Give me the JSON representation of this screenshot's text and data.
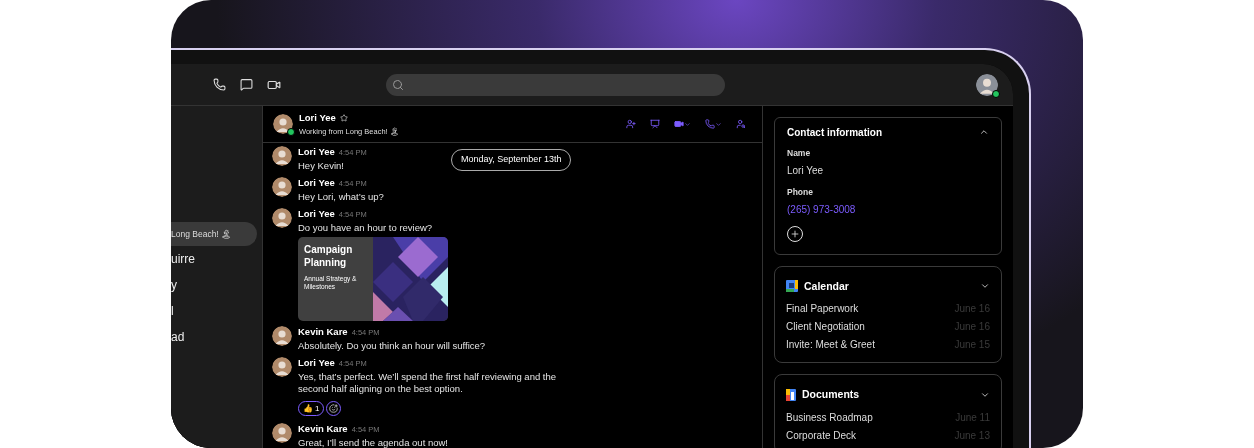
{
  "user": {
    "online": true
  },
  "sidebar": {
    "items": [
      {
        "label": "Long Beach! 🏝",
        "selected": true
      },
      {
        "label": "uirre",
        "selected": false
      },
      {
        "label": "y",
        "selected": false
      },
      {
        "label": "l",
        "selected": false
      },
      {
        "label": "ad",
        "selected": false
      }
    ]
  },
  "chat": {
    "header": {
      "name": "Lori Yee",
      "status": "Working from Long Beach! 🏝",
      "starred": false,
      "online": true
    },
    "date": "Monday, September 13th",
    "messages": [
      {
        "kind": "text",
        "sender": "Lori Yee",
        "time": "4:54 PM",
        "text": "Hey Kevin!"
      },
      {
        "kind": "text",
        "sender": "Lori Yee",
        "time": "4:54 PM",
        "text": "Hey Lori, what’s up?"
      },
      {
        "kind": "attachment",
        "sender": "Lori Yee",
        "time": "4:54 PM",
        "text": "Do you have an hour to review?",
        "attachment": {
          "title": "Campaign Planning",
          "subtitle": "Annual Strategy & Milestones"
        }
      },
      {
        "kind": "text",
        "sender": "Kevin Kare",
        "time": "4:54 PM",
        "text": "Absolutely. Do you think an hour will suffice?"
      },
      {
        "kind": "text",
        "sender": "Lori Yee",
        "time": "4:54 PM",
        "text": "Yes, that’s perfect. We’ll spend the first half reviewing and the second half aligning on the best option.",
        "reactions": [
          {
            "emoji": "👍",
            "count": "1",
            "selected": true
          }
        ]
      },
      {
        "kind": "text",
        "sender": "Kevin Kare",
        "time": "4:54 PM",
        "text": "Great, I’ll send the agenda out now!"
      }
    ]
  },
  "contact": {
    "title": "Contact information",
    "expanded": true,
    "fields": [
      {
        "kind": "text",
        "label": "Name",
        "value": "Lori Yee"
      },
      {
        "kind": "link",
        "label": "Phone",
        "value": "(265) 973-3008"
      }
    ]
  },
  "panels": [
    {
      "kind": "calendar",
      "title": "Calendar",
      "expanded": false,
      "items": [
        {
          "title": "Final Paperwork",
          "date": "June 16"
        },
        {
          "title": "Client Negotiation",
          "date": "June 16"
        },
        {
          "title": "Invite: Meet & Greet",
          "date": "June 15"
        }
      ]
    },
    {
      "kind": "documents",
      "title": "Documents",
      "expanded": false,
      "items": [
        {
          "title": "Business Roadmap",
          "date": "June 11"
        },
        {
          "title": "Corporate Deck",
          "date": "June 13"
        }
      ]
    }
  ]
}
